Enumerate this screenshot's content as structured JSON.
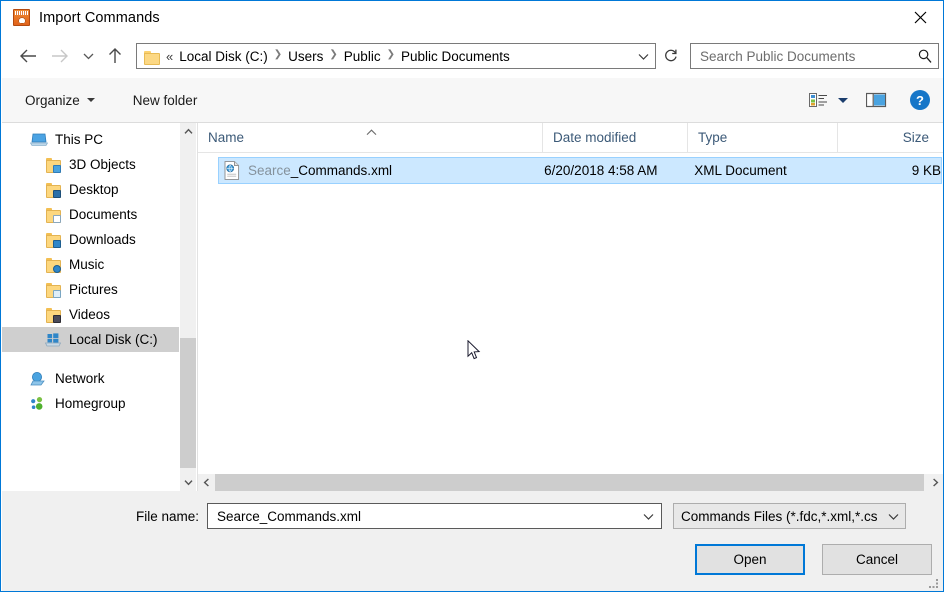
{
  "window": {
    "title": "Import Commands",
    "icon": "app-icon",
    "close_label": "✕"
  },
  "nav": {
    "back": "back-arrow",
    "forward": "forward-arrow",
    "recent": "recent-locations-chevron",
    "up": "up-arrow",
    "refresh": "refresh-icon",
    "address_dropdown": "chevron-down-icon"
  },
  "address": {
    "ellipsis": "«",
    "crumbs": [
      "Local Disk (C:)",
      "Users",
      "Public",
      "Public Documents"
    ],
    "separator": "❯"
  },
  "search": {
    "placeholder": "Search Public Documents",
    "value": "",
    "icon": "search-icon"
  },
  "commandbar": {
    "organize": "Organize",
    "new_folder": "New folder",
    "view_icon": "view-options-icon",
    "pane_icon": "preview-pane-icon",
    "help_icon": "help-icon"
  },
  "sidebar": {
    "items": [
      {
        "label": "This PC",
        "icon": "computer-icon",
        "indent": 0,
        "selected": false
      },
      {
        "label": "3D Objects",
        "icon": "folder-3d-icon",
        "indent": 1,
        "selected": false
      },
      {
        "label": "Desktop",
        "icon": "folder-desktop-icon",
        "indent": 1,
        "selected": false
      },
      {
        "label": "Documents",
        "icon": "folder-documents-icon",
        "indent": 1,
        "selected": false
      },
      {
        "label": "Downloads",
        "icon": "folder-downloads-icon",
        "indent": 1,
        "selected": false
      },
      {
        "label": "Music",
        "icon": "folder-music-icon",
        "indent": 1,
        "selected": false
      },
      {
        "label": "Pictures",
        "icon": "folder-pictures-icon",
        "indent": 1,
        "selected": false
      },
      {
        "label": "Videos",
        "icon": "folder-videos-icon",
        "indent": 1,
        "selected": false
      },
      {
        "label": "Local Disk (C:)",
        "icon": "drive-windows-icon",
        "indent": 1,
        "selected": true
      },
      {
        "label": "Network",
        "icon": "network-icon",
        "indent": 0,
        "selected": false
      },
      {
        "label": "Homegroup",
        "icon": "homegroup-icon",
        "indent": 0,
        "selected": false
      }
    ]
  },
  "filelist": {
    "columns": [
      "Name",
      "Date modified",
      "Type",
      "Size"
    ],
    "sort": {
      "column": "Name",
      "direction": "ascending"
    },
    "rows": [
      {
        "name": "Searce_Commands.xml",
        "name_dim_prefix": "Searce",
        "name_rest": "_Commands.xml",
        "date_modified": "6/20/2018 4:58 AM",
        "type": "XML Document",
        "size": "9 KB",
        "icon": "xml-document-icon",
        "selected": true
      }
    ]
  },
  "footer": {
    "filename_label": "File name:",
    "filename_value": "Searce_Commands.xml",
    "filename_placeholder": "",
    "filter_value": "Commands Files (*.fdc,*.xml,*.cs",
    "open_label": "Open",
    "cancel_label": "Cancel"
  },
  "colors": {
    "accent": "#0078d7",
    "selection": "#cce8ff",
    "selection_border": "#99d1ff",
    "tree_selection": "#cfcfcf",
    "column_header_text": "#3c5a78",
    "chrome": "#f0f0f0"
  }
}
